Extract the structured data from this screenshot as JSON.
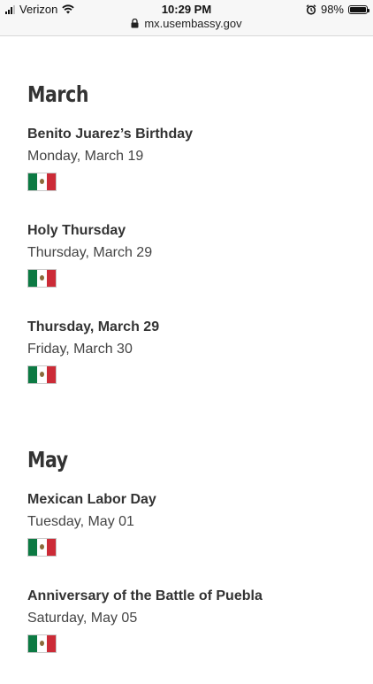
{
  "status_bar": {
    "carrier": "Verizon",
    "time": "10:29 PM",
    "battery": "98%",
    "battery_level": 0.98,
    "icons": [
      "signal-icon",
      "wifi-icon",
      "alarm-icon",
      "battery-icon"
    ]
  },
  "url_bar": {
    "url": "mx.usembassy.gov",
    "icon": "lock-icon"
  },
  "sections": [
    {
      "month": "March",
      "holidays": [
        {
          "name": "Benito Juarez’s Birthday",
          "date": "Monday, March 19"
        },
        {
          "name": "Holy Thursday",
          "date": "Thursday, March 29"
        },
        {
          "name": "Thursday, March 29",
          "date": "Friday, March 30"
        }
      ]
    },
    {
      "month": "May",
      "holidays": [
        {
          "name": "Mexican Labor Day",
          "date": "Tuesday, May 01"
        },
        {
          "name": "Anniversary of the Battle of Puebla",
          "date": "Saturday, May 05"
        }
      ]
    }
  ],
  "colors": {
    "flag_green": "#0c7a43",
    "flag_white": "#ffffff",
    "flag_red": "#cc2b37",
    "text": "#333333"
  }
}
